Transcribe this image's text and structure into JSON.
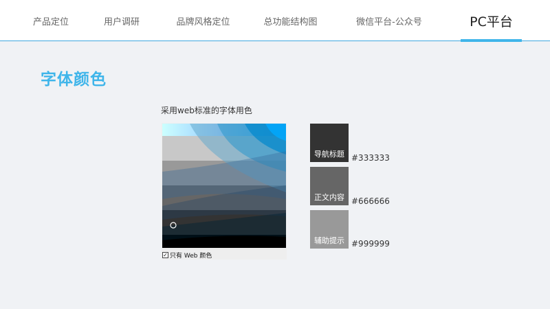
{
  "nav": {
    "tabs": [
      {
        "label": "产品定位"
      },
      {
        "label": "用户调研"
      },
      {
        "label": "品牌风格定位"
      },
      {
        "label": "总功能结构图"
      },
      {
        "label": "微信平台-公众号"
      },
      {
        "label": "PC平台"
      }
    ],
    "active_index": 5,
    "accent": "#3fb5ea"
  },
  "section": {
    "title": "字体颜色",
    "subtitle": "采用web标准的字体用色"
  },
  "picker": {
    "checkbox_label": "只有 Web 颜色",
    "checked": true
  },
  "swatches": [
    {
      "label": "导航标题",
      "hex": "#333333",
      "color": "#333333"
    },
    {
      "label": "正文内容",
      "hex": "#666666",
      "color": "#666666"
    },
    {
      "label": "辅助提示",
      "hex": "#999999",
      "color": "#999999"
    }
  ]
}
